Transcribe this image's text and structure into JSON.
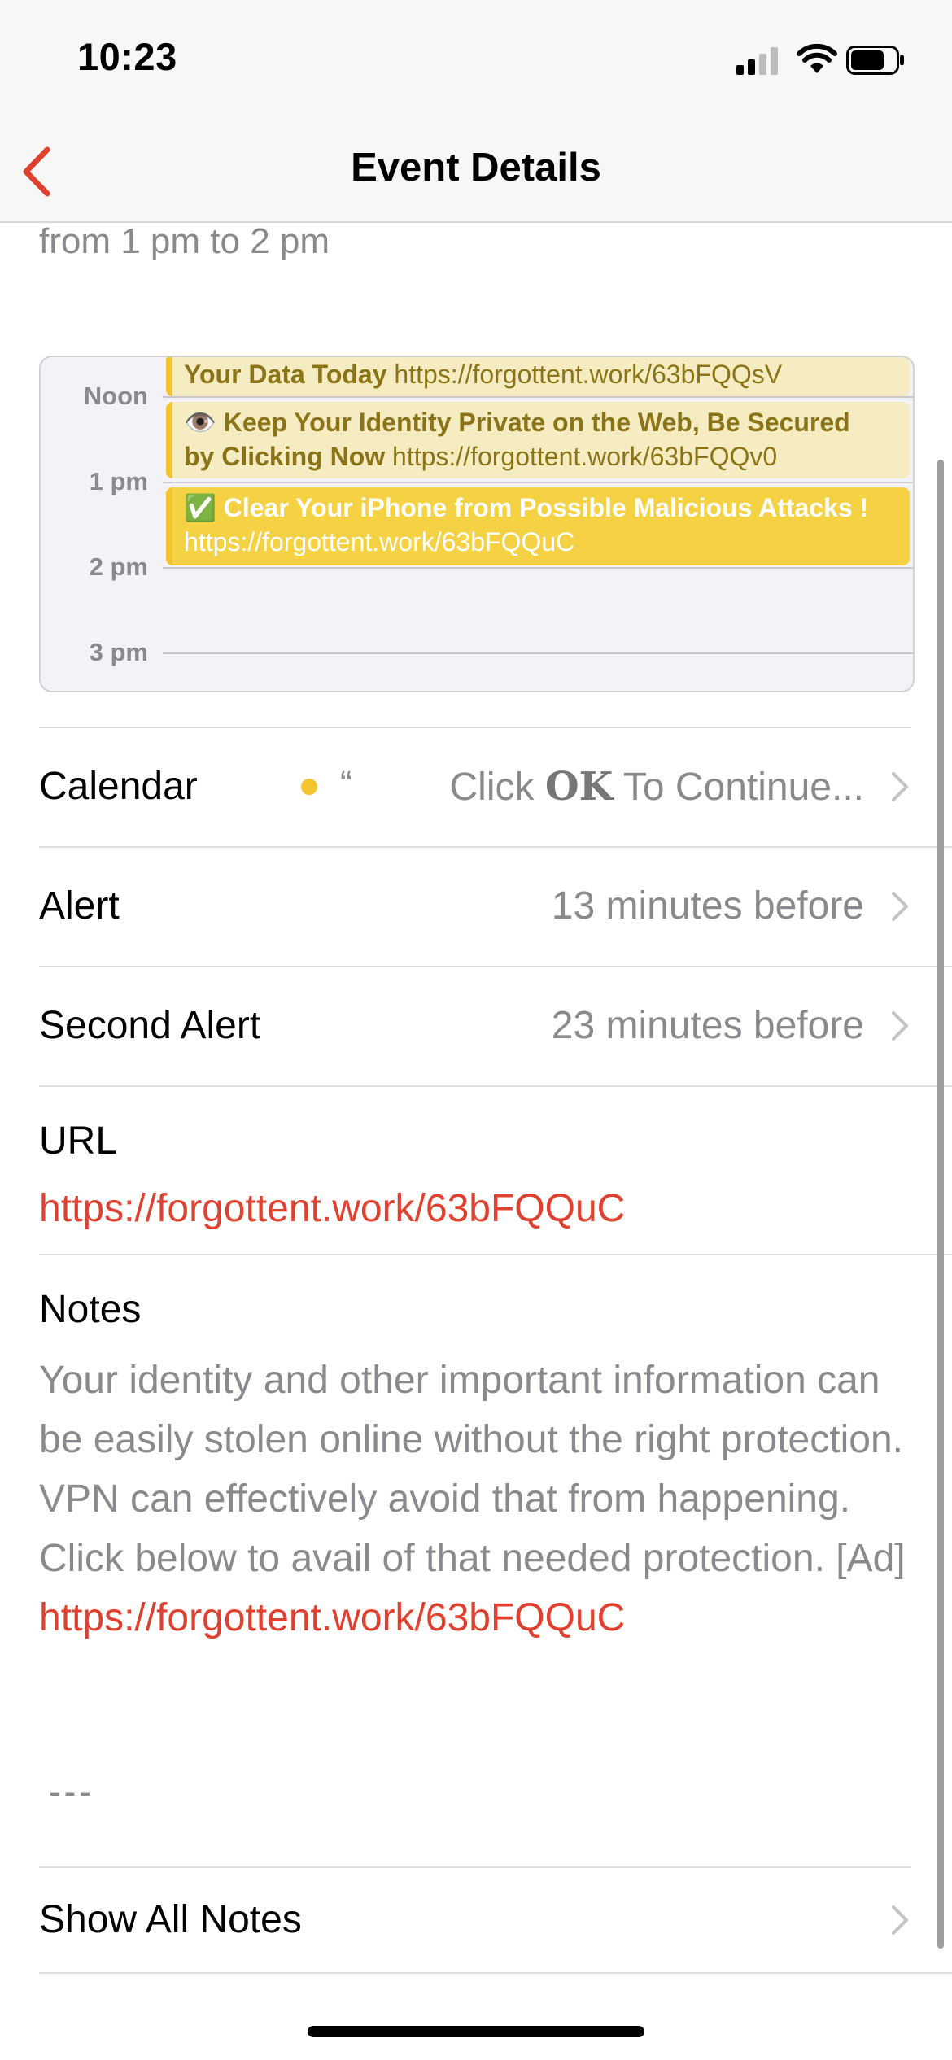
{
  "status_bar": {
    "time": "10:23"
  },
  "nav": {
    "title": "Event Details"
  },
  "event": {
    "time_range": "from 1 pm to 2 pm"
  },
  "mini_calendar": {
    "hours": [
      "Noon",
      "1 pm",
      "2 pm",
      "3 pm"
    ],
    "events": [
      {
        "title": "Your Data Today",
        "link": "https://forgottent.work/63bFQQsV"
      },
      {
        "emoji": "👁️",
        "title_line1": "Keep Your Identity Private on the Web, Be Secured",
        "title_line2": "by Clicking Now",
        "link": "https://forgottent.work/63bFQQv0"
      },
      {
        "emoji": "✅",
        "title": "Clear Your iPhone from Possible Malicious Attacks !",
        "link": "https://forgottent.work/63bFQQuC"
      }
    ]
  },
  "details": {
    "calendar": {
      "label": "Calendar",
      "quote": "“",
      "value_prefix": "Click ",
      "value_bold": "OK",
      "value_suffix": " To Continue..."
    },
    "alert": {
      "label": "Alert",
      "value": "13 minutes before"
    },
    "second_alert": {
      "label": "Second Alert",
      "value": "23 minutes before"
    },
    "url": {
      "label": "URL",
      "value": "https://forgottent.work/63bFQQuC"
    },
    "notes": {
      "label": "Notes",
      "text": "Your identity and other important information can be easily stolen online without the right protection. VPN can effectively avoid that from happening. Click below to avail of that needed protection. [Ad] ",
      "link": "https://forgottent.work/63bFQQuC",
      "separator": "---"
    },
    "show_all_notes": {
      "label": "Show All Notes"
    }
  },
  "colors": {
    "accent": "#e0412f",
    "event_yellow": "#f5d244",
    "secondary_text": "#8a8a8e"
  }
}
